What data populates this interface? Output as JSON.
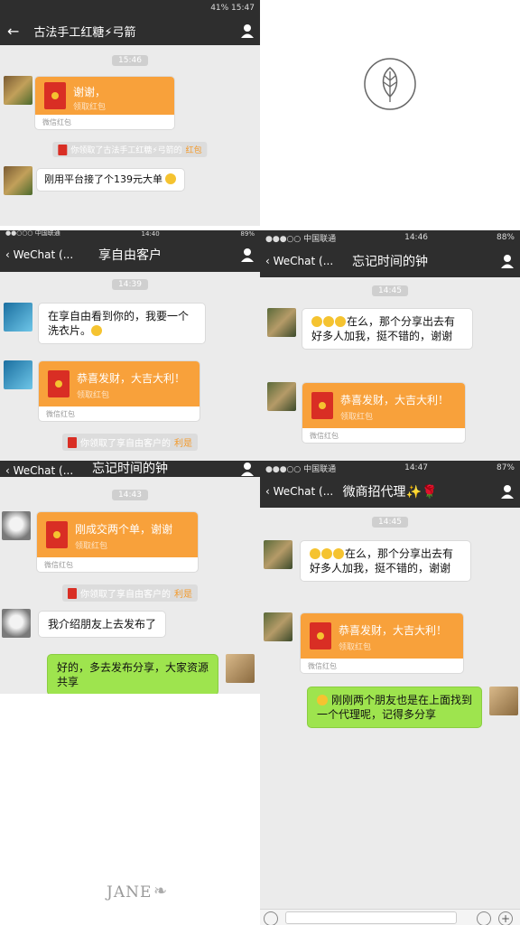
{
  "colors": {
    "navbar": "#2e2e2e",
    "chat_bg": "#ebebeb",
    "red_packet": "#f8a13b",
    "my_bubble": "#9ee44e"
  },
  "p1": {
    "status": {
      "left": "",
      "right": "41%  15:47"
    },
    "title": "古法手工红糖⚡弓箭",
    "time": "15:46",
    "packet": {
      "greeting": "谢谢，",
      "claim": "领取红包",
      "footer": "微信红包"
    },
    "notice": {
      "pre": "你领取了古法手工红糖⚡弓箭的",
      "link": "红包"
    },
    "msg": "刚用平台接了个139元大单"
  },
  "p2": {
    "status": {
      "left": "●●○○○ 中国联通",
      "center": "14:40",
      "right": "89%"
    },
    "back": "WeChat (...",
    "title": "享自由客户",
    "time": "14:39",
    "msg": "在享自由看到你的，我要一个洗衣片。",
    "packet": {
      "greeting": "恭喜发财，大吉大利！",
      "claim": "领取红包",
      "footer": "微信红包"
    },
    "notice": {
      "pre": "你领取了享自由客户的",
      "link": "利是"
    }
  },
  "p3": {
    "status": {
      "left": "●●●○○ 中国联通",
      "center": "14:46",
      "right": "88%"
    },
    "back": "WeChat (...",
    "title": "忘记时间的钟",
    "time": "14:45",
    "msg": "在么，那个分享出去有好多人加我，挺不错的，谢谢",
    "packet": {
      "greeting": "恭喜发财，大吉大利！",
      "claim": "领取红包",
      "footer": "微信红包"
    }
  },
  "p4": {
    "back": "WeChat (...",
    "title": "忘记时间的钟",
    "time": "14:43",
    "packet": {
      "greeting": "刚成交两个单，谢谢",
      "claim": "领取红包",
      "footer": "微信红包"
    },
    "notice": {
      "pre": "你领取了享自由客户的",
      "link": "利是"
    },
    "msg1": "我介绍朋友上去发布了",
    "msg2": "好的，多去发布分享，大家资源共享"
  },
  "p5": {
    "status": {
      "left": "●●●○○ 中国联通",
      "center": "14:47",
      "right": "87%"
    },
    "back": "WeChat (...",
    "title": "微商招代理✨🌹",
    "time": "14:45",
    "msg": "在么，那个分享出去有好多人加我，挺不错的，谢谢",
    "packet": {
      "greeting": "恭喜发财，大吉大利！",
      "claim": "领取红包",
      "footer": "微信红包"
    },
    "msg2": "刚刚两个朋友也是在上面找到一个代理呢，记得多分享"
  },
  "watermark": "JANE"
}
